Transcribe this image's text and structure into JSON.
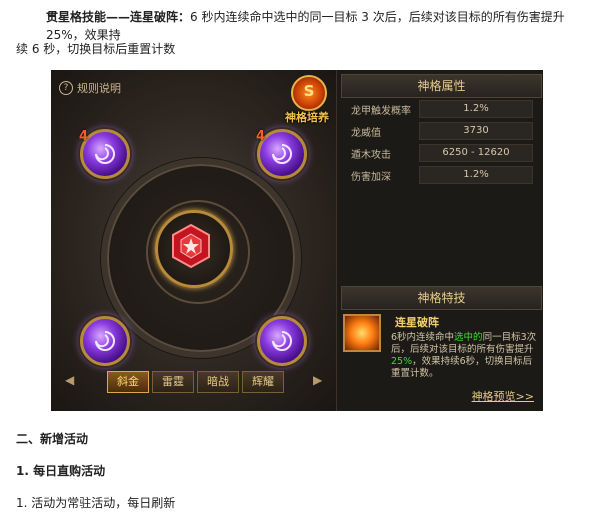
{
  "article": {
    "intro_title": "贯星格技能——连星破阵：",
    "intro_rest": "6 秒内连续命中选中的同一目标 3 次后，后续对该目标的所有伤害提升 25%，效果持",
    "intro_line2": "续 6 秒，切换目标后重置计数",
    "section2": "二、新增活动",
    "subsection1": "1. 每日直购活动",
    "item1": "1. 活动为常驻活动，每日刷新"
  },
  "game": {
    "rules_link": "规则说明",
    "badge_label": "神格培养",
    "orbs": [
      {
        "count": "4"
      },
      {
        "count": "4"
      },
      {
        "count": ""
      },
      {
        "count": ""
      }
    ],
    "tabs": [
      "斜金",
      "雷霆",
      "暗战",
      "辉耀"
    ],
    "active_tab": 0,
    "attributes_title": "神格属性",
    "attributes": [
      {
        "name": "龙甲触发概率",
        "value": "1.2%"
      },
      {
        "name": "龙威值",
        "value": "3730"
      },
      {
        "name": "遁木攻击",
        "value": "6250 - 12620"
      },
      {
        "name": "伤害加深",
        "value": "1.2%"
      }
    ],
    "skill_title": "神格特技",
    "skill_name": "连星破阵",
    "skill_desc_a": "6秒内连续命中",
    "skill_desc_b": "选中的",
    "skill_desc_c": "同一目标3次后，后续对该目标的所有伤害提升",
    "skill_desc_d": "25%",
    "skill_desc_e": "，效果持续6秒，切换目标后重置计数。",
    "preview_link": "神格预览>>"
  },
  "colors": {
    "accent_gold": "#e6c98c",
    "highlight_green": "#3fdc37",
    "orb_purple": "#8a3be0"
  }
}
